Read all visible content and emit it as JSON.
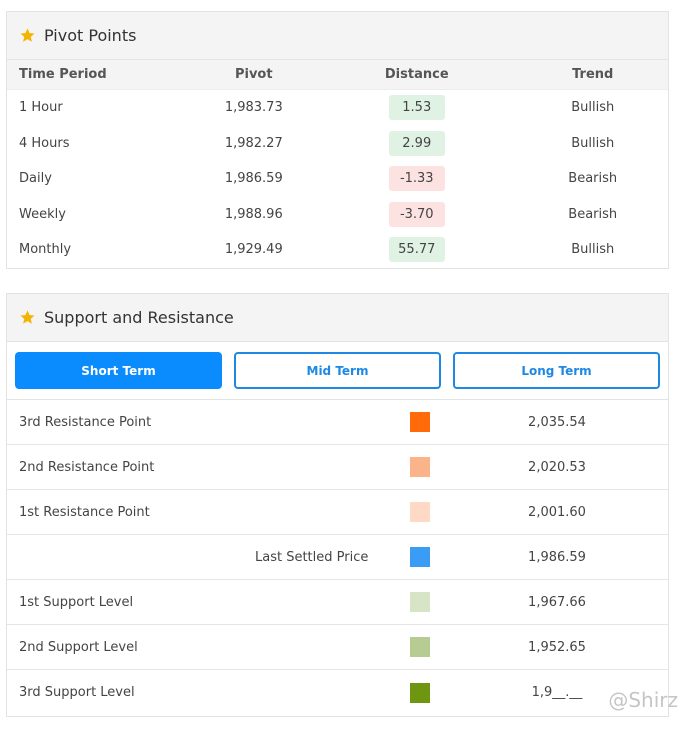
{
  "pivot_points": {
    "title": "Pivot Points",
    "columns": [
      "Time Period",
      "Pivot",
      "Distance",
      "Trend"
    ],
    "rows": [
      {
        "period": "1 Hour",
        "pivot": "1,983.73",
        "distance": "1.53",
        "trend": "Bullish",
        "sign": "positive"
      },
      {
        "period": "4 Hours",
        "pivot": "1,982.27",
        "distance": "2.99",
        "trend": "Bullish",
        "sign": "positive"
      },
      {
        "period": "Daily",
        "pivot": "1,986.59",
        "distance": "-1.33",
        "trend": "Bearish",
        "sign": "negative"
      },
      {
        "period": "Weekly",
        "pivot": "1,988.96",
        "distance": "-3.70",
        "trend": "Bearish",
        "sign": "negative"
      },
      {
        "period": "Monthly",
        "pivot": "1,929.49",
        "distance": "55.77",
        "trend": "Bullish",
        "sign": "positive"
      }
    ]
  },
  "support_resistance": {
    "title": "Support and Resistance",
    "tabs": [
      {
        "label": "Short Term",
        "active": true
      },
      {
        "label": "Mid Term",
        "active": false
      },
      {
        "label": "Long Term",
        "active": false
      }
    ],
    "levels": [
      {
        "label": "3rd Resistance Point",
        "value": "2,035.54",
        "color": "#ff6a0a",
        "centered": false
      },
      {
        "label": "2nd Resistance Point",
        "value": "2,020.53",
        "color": "#fbb48a",
        "centered": false
      },
      {
        "label": "1st Resistance Point",
        "value": "2,001.60",
        "color": "#fdd9c6",
        "centered": false
      },
      {
        "label": "Last Settled Price",
        "value": "1,986.59",
        "color": "#3b9cf5",
        "centered": true
      },
      {
        "label": "1st Support Level",
        "value": "1,967.66",
        "color": "#d8e4c6",
        "centered": false
      },
      {
        "label": "2nd Support Level",
        "value": "1,952.65",
        "color": "#b6cc93",
        "centered": false
      },
      {
        "label": "3rd Support Level",
        "value": "1,9__.__",
        "color": "#6f9611",
        "centered": false
      }
    ]
  },
  "colors": {
    "positive_chip": "#dff2e4",
    "negative_chip": "#fde2e2",
    "accent": "#0a8cff",
    "star": "#f5b301"
  },
  "watermark": "@Shirz"
}
